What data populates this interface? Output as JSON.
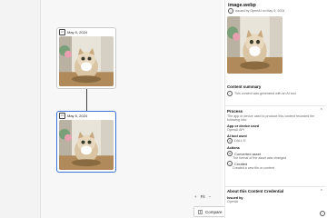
{
  "canvas": {
    "nodes": [
      {
        "date": "May 5, 2024"
      },
      {
        "date": "May 5, 2024"
      }
    ],
    "zoom": {
      "label": "Fit"
    },
    "compare_label": "Compare"
  },
  "panel": {
    "file_name": "image.webp",
    "issued_line": "Issued by OpenAI on May 5, 2024",
    "content_summary": {
      "heading": "Content summary",
      "text": "This content was generated with an AI tool."
    },
    "process": {
      "heading": "Process",
      "description": "The app or device used to produce this content recorded the following info:",
      "app_heading": "App or device used",
      "app_value": "OpenAI API",
      "ai_heading": "AI tool used",
      "ai_value": "DALL·E",
      "actions_heading": "Actions",
      "actions": [
        {
          "name": "Converted asset",
          "desc": "The format of the asset was changed"
        },
        {
          "name": "Created",
          "desc": "Created a new file or content"
        }
      ]
    },
    "about": {
      "heading": "About this Content Credential",
      "issued_by_heading": "Issued by",
      "issued_by_value": "OpenAI"
    }
  }
}
